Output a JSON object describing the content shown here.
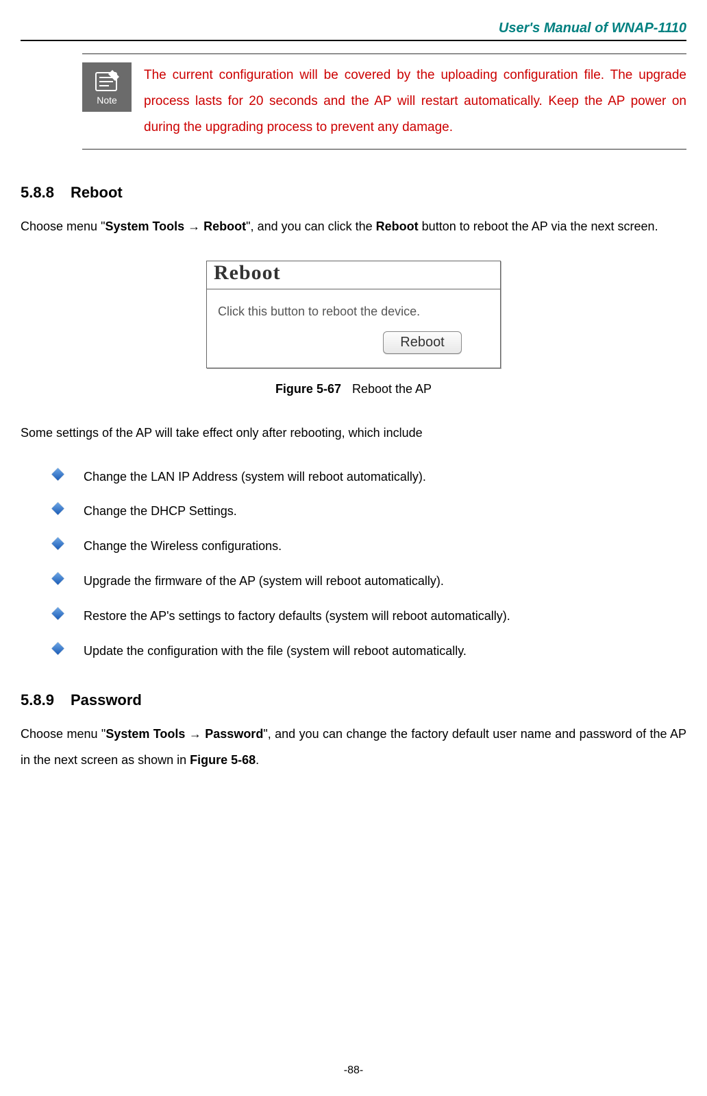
{
  "header": {
    "title": "User's Manual of WNAP-1110"
  },
  "note": {
    "icon_label": "Note",
    "text": "The current configuration will be covered by the uploading configuration file. The upgrade process lasts for 20 seconds and the AP will restart automatically. Keep the AP power on during the upgrading process to prevent any damage."
  },
  "section_reboot": {
    "number": "5.8.8",
    "title": "Reboot",
    "intro_pre": "Choose menu \"",
    "intro_menu": "System Tools → Reboot",
    "intro_mid": "\", and you can click the ",
    "intro_btn": "Reboot",
    "intro_post": " button to reboot the AP via the next screen."
  },
  "reboot_box": {
    "title": "Reboot",
    "body": "Click this button to reboot the device.",
    "button": "Reboot"
  },
  "figure_caption": {
    "label": "Figure 5-67",
    "text": "Reboot the AP"
  },
  "effects_intro": "Some settings of the AP will take effect only after rebooting, which include",
  "bullets": [
    "Change the LAN IP Address (system will reboot automatically).",
    "Change the DHCP Settings.",
    "Change the Wireless configurations.",
    "Upgrade the firmware of the AP (system will reboot automatically).",
    "Restore the AP's settings to factory defaults (system will reboot automatically).",
    "Update the configuration with the file (system will reboot automatically."
  ],
  "section_password": {
    "number": "5.8.9",
    "title": "Password",
    "intro_pre": "Choose menu \"",
    "intro_menu": "System Tools → Password",
    "intro_mid": "\", and you can change the factory default user name and password of the AP in the next screen as shown in ",
    "intro_fig": "Figure 5-68",
    "intro_post": "."
  },
  "page_number": "-88-"
}
